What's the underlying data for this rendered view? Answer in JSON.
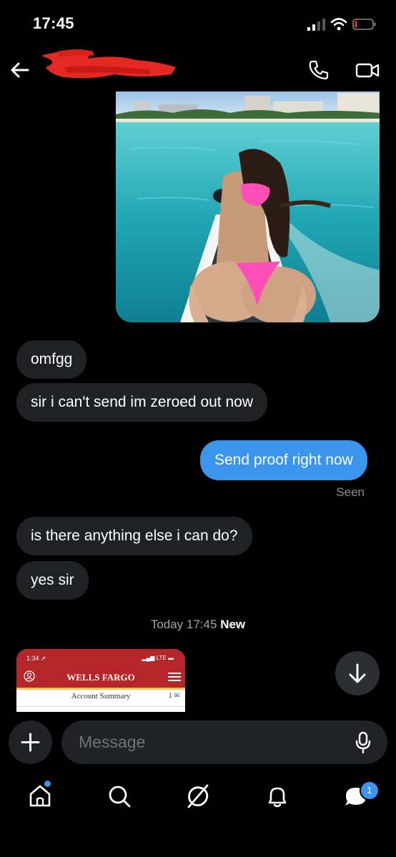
{
  "status_bar": {
    "time": "17:45"
  },
  "conversation": {
    "messages": [
      {
        "text": "omfgg"
      },
      {
        "text": "sir i can't send im zeroed out now"
      },
      {
        "text": "Send proof right now"
      },
      {
        "text": "is there anything else i can do?"
      },
      {
        "text": "yes sir"
      }
    ],
    "seen_label": "Seen",
    "divider": {
      "time": "Today 17:45",
      "new_label": "New"
    }
  },
  "preview": {
    "time": "1:34",
    "network": "LTE",
    "brand": "WELLS FARGO",
    "subtitle": "Account Summary",
    "mail_count": "1"
  },
  "compose": {
    "placeholder": "Message"
  },
  "tab_bar": {
    "messages_badge": "1"
  },
  "colors": {
    "accent": "#3b95ec",
    "bubble_received": "#1f2124",
    "background": "#000000",
    "wells_fargo_red": "#b5252a",
    "wells_fargo_gold": "#f5c54a"
  },
  "icons": [
    "arrow-left-icon",
    "phone-icon",
    "video-camera-icon",
    "arrow-down-icon",
    "plus-icon",
    "microphone-icon",
    "home-icon",
    "search-icon",
    "grok-icon",
    "bell-icon",
    "messages-icon"
  ]
}
